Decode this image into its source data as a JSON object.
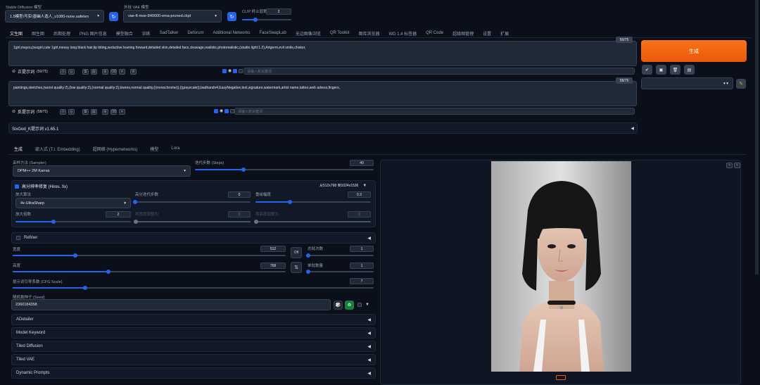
{
  "top": {
    "model_label": "Stable Diffusion 模型",
    "model_value": "1.5模型\\写实\\墨幽人造人_v1080-none.safeten",
    "vae_label": "外挂 VAE 模型",
    "vae_value": "vae-ft-mse-840000-ema-pruned.ckpt",
    "clip_label": "CLIP 终止层数",
    "clip_value": "2",
    "clip_level": 0.27,
    "refresh_glyph": "↻"
  },
  "tabs": [
    "文生图",
    "图生图",
    "后期处理",
    "PNG 图片信息",
    "模型融合",
    "训练",
    "SadTalker",
    "Deforum",
    "Additional Networks",
    "FaceSwapLab",
    "无边图像浏览",
    "QR Toolkit",
    "图库浏览器",
    "WD 1.4 标签器",
    "QR Code",
    "超级图管理",
    "设置",
    "扩展"
  ],
  "prompt": {
    "text": "1girl,mayou,bsxgirl,cute 1girl,messy long black hair,lip biting,seductive leaning forward,detailed skin,detailed face,cleavage,realistic,photorealistic,(studio light:1.2),Artgerm,evil smile,choker,",
    "counter": "50/75",
    "label": "正提示词",
    "label_counter": "(50/75)",
    "keyword_placeholder": "请输入新关键词"
  },
  "negative": {
    "text": "paintings,sketches,(worst quality:2),(low quality:2),(normal quality:2),lowres,normal quality,((monochrome)),((grayscale)),badhandv4,EasyNegative,text,signature,watermark,artist name,tattoo,web adress,fingers,",
    "counter": "58/75",
    "label": "反提示词",
    "label_counter": "(58/75)",
    "keyword_placeholder": "请输入新关键词"
  },
  "generate_label": "生成",
  "style_tools": [
    "✔",
    "▣",
    "🗑",
    "▤"
  ],
  "style_pencil": "✎",
  "extension_bar": "SixGod_K提示词 v1.65.1",
  "subtabs": [
    "生成",
    "嵌入式 (T.I. Embedding)",
    "超网络 (Hypernetworks)",
    "模型",
    "Lora"
  ],
  "sampler": {
    "label": "采样方法 (Sampler)",
    "value": "DPM++ 2M Karras"
  },
  "steps": {
    "label": "迭代步数 (Steps)",
    "value": "40",
    "level": 0.27
  },
  "hires": {
    "label": "高分辨率修复 (Hires. fix)",
    "info": "从512x768 到1024x1536",
    "upscaler_label": "放大算法",
    "upscaler_value": "4x-UltraSharp",
    "hires_steps_label": "高分迭代步数",
    "hires_steps_value": "0",
    "hires_steps_level": 0.0,
    "denoise_label": "重绘幅度",
    "denoise_value": "0.3",
    "denoise_level": 0.3,
    "scale_label": "放大倍数",
    "scale_value": "2",
    "scale_level": 0.33,
    "resize_w_label": "将宽度调整为",
    "resize_w_value": "0",
    "resize_h_label": "将高度调整为",
    "resize_h_value": "0"
  },
  "refiner_label": "Refiner",
  "width": {
    "label": "宽度",
    "value": "512",
    "level": 0.23
  },
  "height": {
    "label": "高度",
    "value": "768",
    "level": 0.35
  },
  "batch_count": {
    "label": "总批次数",
    "value": "1"
  },
  "batch_size": {
    "label": "单批数量",
    "value": "1"
  },
  "swap_label": "⇅",
  "off_label": "Off",
  "cfg": {
    "label": "提示词引导系数 (CFG Scale)",
    "value": "7",
    "level": 0.2
  },
  "seed": {
    "label": "随机数种子 (Seed)",
    "value": "2360184358",
    "dice": "🎲",
    "recycle": "♻"
  },
  "accordions": [
    "ADetailer",
    "Model Keyword",
    "Tiled Diffusion",
    "Tiled VAE",
    "Dynamic Prompts"
  ],
  "output": {
    "close1": "×",
    "close2": "×"
  },
  "colors": {
    "accent": "#2563eb",
    "generate": "#ea580c",
    "bg": "#0b0f19"
  }
}
